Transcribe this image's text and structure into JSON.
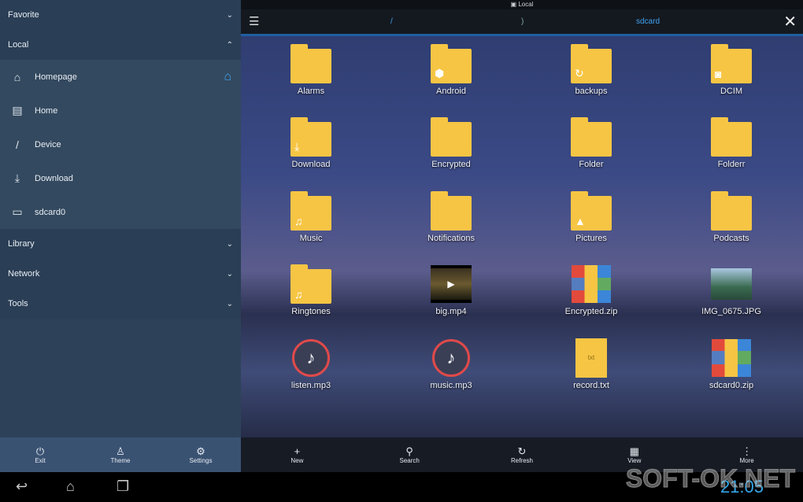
{
  "sidebar": {
    "favorite": "Favorite",
    "local": "Local",
    "items": [
      {
        "label": "Homepage",
        "icon": "home-icon"
      },
      {
        "label": "Home",
        "icon": "home-folder-icon"
      },
      {
        "label": "Device",
        "icon": "slash-icon"
      },
      {
        "label": "Download",
        "icon": "download-icon"
      },
      {
        "label": "sdcard0",
        "icon": "sdcard-icon"
      }
    ],
    "library": "Library",
    "network": "Network",
    "tools": "Tools",
    "bottom": [
      {
        "label": "Exit",
        "icon": "exit-icon"
      },
      {
        "label": "Theme",
        "icon": "theme-shirt-icon"
      },
      {
        "label": "Settings",
        "icon": "settings-icon"
      }
    ]
  },
  "status": {
    "label": "Local"
  },
  "toolbar": {
    "path_root": "/",
    "separator": ")",
    "current": "sdcard"
  },
  "files": [
    {
      "name": "Alarms",
      "type": "folder",
      "glyph": ""
    },
    {
      "name": "Android",
      "type": "folder",
      "glyph": "⬢"
    },
    {
      "name": "backups",
      "type": "folder",
      "glyph": "↻"
    },
    {
      "name": "DCIM",
      "type": "folder",
      "glyph": "◙"
    },
    {
      "name": "Download",
      "type": "folder",
      "glyph": "⤓"
    },
    {
      "name": "Encrypted",
      "type": "folder",
      "glyph": ""
    },
    {
      "name": "Folder",
      "type": "folder",
      "glyph": ""
    },
    {
      "name": "Folderr",
      "type": "folder",
      "glyph": ""
    },
    {
      "name": "Music",
      "type": "folder",
      "glyph": "♫"
    },
    {
      "name": "Notifications",
      "type": "folder",
      "glyph": ""
    },
    {
      "name": "Pictures",
      "type": "folder",
      "glyph": "▲"
    },
    {
      "name": "Podcasts",
      "type": "folder",
      "glyph": ""
    },
    {
      "name": "Ringtones",
      "type": "folder",
      "glyph": "♫"
    },
    {
      "name": "big.mp4",
      "type": "video",
      "glyph": "▶"
    },
    {
      "name": "Encrypted.zip",
      "type": "zip",
      "glyph": ""
    },
    {
      "name": "IMG_0675.JPG",
      "type": "image",
      "glyph": ""
    },
    {
      "name": "listen.mp3",
      "type": "mp3",
      "glyph": "♪"
    },
    {
      "name": "music.mp3",
      "type": "mp3",
      "glyph": "♪"
    },
    {
      "name": "record.txt",
      "type": "txt",
      "glyph": "txt"
    },
    {
      "name": "sdcard0.zip",
      "type": "zip",
      "glyph": ""
    }
  ],
  "bottom_bar": [
    {
      "label": "New",
      "icon": "plus-icon"
    },
    {
      "label": "Search",
      "icon": "search-icon"
    },
    {
      "label": "Refresh",
      "icon": "refresh-icon"
    },
    {
      "label": "View",
      "icon": "grid-view-icon"
    },
    {
      "label": "More",
      "icon": "more-vertical-icon"
    }
  ],
  "system": {
    "clock": "21:05",
    "watermark": "SOFT-OK.NET"
  },
  "colors": {
    "accent": "#3fa2f0",
    "folder": "#f6c544",
    "sidebar": "#2d4259"
  }
}
